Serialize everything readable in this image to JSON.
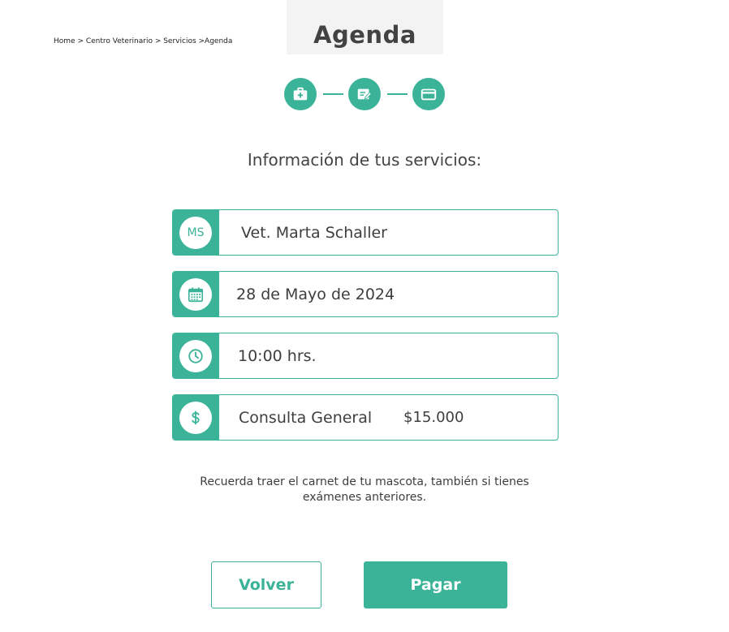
{
  "breadcrumb": "Home > Centro Veterinario > Servicios >Agenda",
  "page_title": "Agenda",
  "steps": [
    {
      "icon": "medical-kit-icon"
    },
    {
      "icon": "edit-form-icon"
    },
    {
      "icon": "credit-card-icon"
    }
  ],
  "section_heading": "Información de tus servicios:",
  "details": {
    "vet_initials": "MS",
    "vet_name": "Vet. Marta Schaller",
    "date": "28 de Mayo de 2024",
    "time": "10:00 hrs.",
    "service": "Consulta General",
    "price": "$15.000"
  },
  "note": "Recuerda traer el carnet de tu mascota, también si tienes exámenes anteriores.",
  "buttons": {
    "back": "Volver",
    "pay": "Pagar"
  },
  "colors": {
    "accent": "#3bb398"
  }
}
